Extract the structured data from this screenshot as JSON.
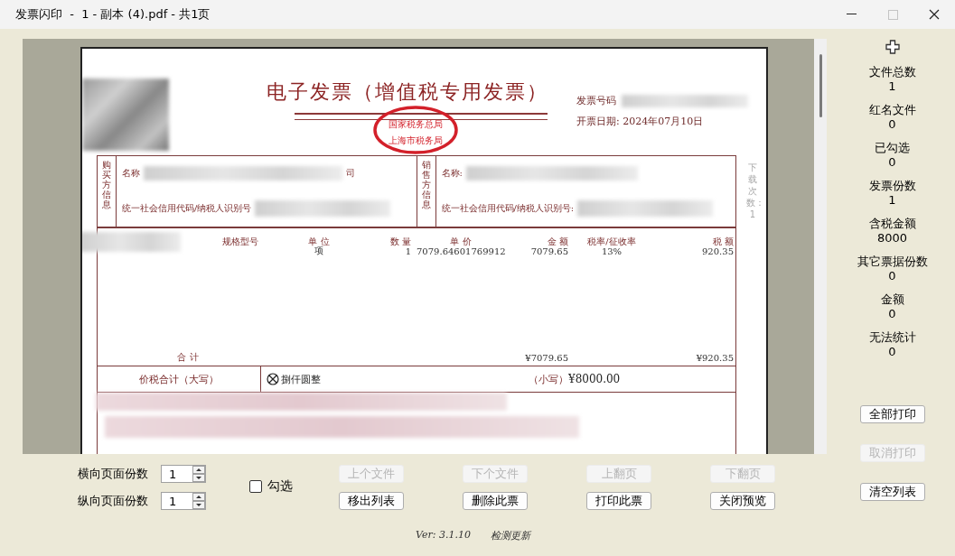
{
  "window": {
    "title": "发票闪印  -  1 - 副本 (4).pdf - 共1页",
    "controls": [
      {
        "kind": "minimize",
        "disabled": false
      },
      {
        "kind": "maximize",
        "disabled": true
      },
      {
        "kind": "close",
        "disabled": false
      }
    ]
  },
  "invoice": {
    "title": "电子发票（增值税专用发票）",
    "stamp_top": "国家税务总局",
    "stamp_bottom": "上海市税务局",
    "number_label": "发票号码",
    "date": "开票日期: 2024年07月10日",
    "buyer_label": "购买方信息",
    "buyer_name_label": "名称",
    "buyer_name_tail": "司",
    "buyer_id_label": "统一社会信用代码/纳税人识别号",
    "seller_label": "销售方信息",
    "seller_name_label": "名称:",
    "seller_id_label": "统一社会信用代码/纳税人识别号:",
    "download_count": "下载次数：1",
    "columns": [
      "规格型号",
      "单 位",
      "数 量",
      "单 价",
      "金 额",
      "税率/征收率",
      "税 额"
    ],
    "item": {
      "unit": "项",
      "qty": "1",
      "price": "7079.64601769912",
      "amount": "7079.65",
      "rate": "13%",
      "tax": "920.35"
    },
    "total_label": "合 计",
    "total_amount": "¥7079.65",
    "total_tax": "¥920.35",
    "grand_label": "价税合计（大写）",
    "grand_words": "捌仟圆整",
    "grand_small_label": "（小写）",
    "grand_small": "¥8000.00"
  },
  "copies": [
    {
      "label": "横向页面份数",
      "value": "1"
    },
    {
      "label": "纵向页面份数",
      "value": "1"
    }
  ],
  "select_checkbox": {
    "label": "勾选",
    "checked": false
  },
  "nav_buttons": [
    {
      "label": "上个文件",
      "disabled": true
    },
    {
      "label": "下个文件",
      "disabled": true
    },
    {
      "label": "上翻页",
      "disabled": true
    },
    {
      "label": "下翻页",
      "disabled": true
    },
    {
      "label": "移出列表",
      "disabled": false
    },
    {
      "label": "删除此票",
      "disabled": false
    },
    {
      "label": "打印此票",
      "disabled": false
    },
    {
      "label": "关闭预览",
      "disabled": false
    }
  ],
  "version": "Ver: 3.1.10",
  "check_update": "检测更新",
  "stats": [
    {
      "label": "文件总数",
      "value": "1"
    },
    {
      "label": "红名文件",
      "value": "0"
    },
    {
      "label": "已勾选",
      "value": "0"
    },
    {
      "label": "发票份数",
      "value": "1"
    },
    {
      "label": "含税金额",
      "value": "8000"
    },
    {
      "label": "其它票据份数",
      "value": "0"
    },
    {
      "label": "金额",
      "value": "0"
    },
    {
      "label": "无法统计",
      "value": "0"
    }
  ],
  "side_buttons": [
    {
      "label": "全部打印",
      "disabled": false
    },
    {
      "label": "取消打印",
      "disabled": true
    },
    {
      "label": "清空列表",
      "disabled": false
    }
  ]
}
